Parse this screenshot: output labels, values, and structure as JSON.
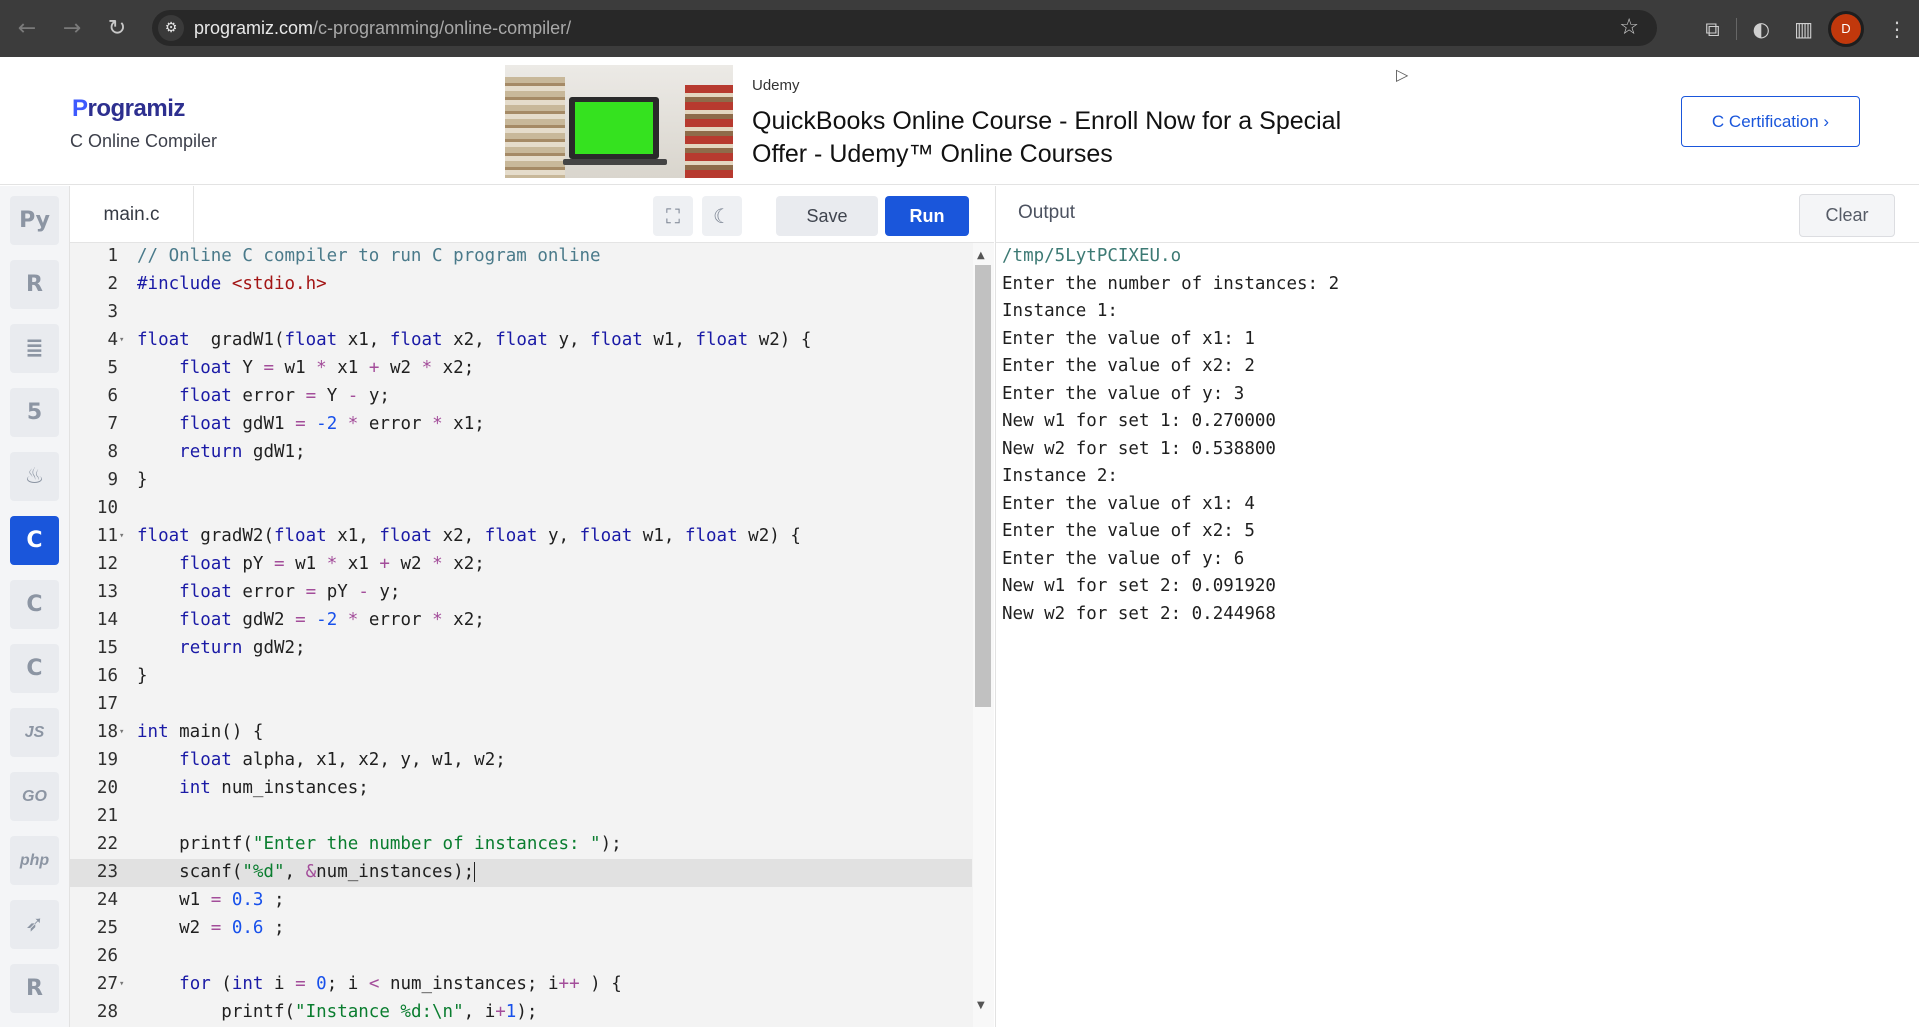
{
  "browser": {
    "url_host": "programiz.com",
    "url_path": "/c-programming/online-compiler/",
    "avatar_letter": "D"
  },
  "header": {
    "logo_text": "rogramiz",
    "logo_p": "P",
    "subtitle": "C Online Compiler",
    "ad_source": "Udemy",
    "ad_title": "QuickBooks Online Course - Enroll Now for a Special Offer - Udemy™ Online Courses",
    "cert_button": "C Certification ›"
  },
  "languages": [
    {
      "name": "python-icon",
      "glyph": "Py"
    },
    {
      "name": "r-icon",
      "glyph": "R"
    },
    {
      "name": "sql-icon",
      "glyph": "≣"
    },
    {
      "name": "html-icon",
      "glyph": "5"
    },
    {
      "name": "java-icon",
      "glyph": "♨"
    },
    {
      "name": "c-icon",
      "glyph": "C",
      "active": true
    },
    {
      "name": "cpp-icon",
      "glyph": "C"
    },
    {
      "name": "csharp-icon",
      "glyph": "C"
    },
    {
      "name": "javascript-icon",
      "glyph": "JS"
    },
    {
      "name": "go-icon",
      "glyph": "GO"
    },
    {
      "name": "php-icon",
      "glyph": "php"
    },
    {
      "name": "swift-icon",
      "glyph": "➶"
    },
    {
      "name": "rust-icon",
      "glyph": "R"
    }
  ],
  "editor": {
    "file_name": "main.c",
    "save_label": "Save",
    "run_label": "Run"
  },
  "code_lines": [
    [
      [
        "cm",
        "// Online C compiler to run C program online"
      ]
    ],
    [
      [
        "kw",
        "#include "
      ],
      [
        "inc",
        "<stdio.h>"
      ]
    ],
    [],
    [
      [
        "kw",
        "float"
      ],
      [
        "",
        "  gradW1("
      ],
      [
        "kw",
        "float"
      ],
      [
        "",
        " x1, "
      ],
      [
        "kw",
        "float"
      ],
      [
        "",
        " x2, "
      ],
      [
        "kw",
        "float"
      ],
      [
        "",
        " y, "
      ],
      [
        "kw",
        "float"
      ],
      [
        "",
        " w1, "
      ],
      [
        "kw",
        "float"
      ],
      [
        "",
        " w2) {"
      ]
    ],
    [
      [
        "",
        "    "
      ],
      [
        "kw",
        "float"
      ],
      [
        "",
        " Y "
      ],
      [
        "op",
        "="
      ],
      [
        "",
        " w1 "
      ],
      [
        "op",
        "*"
      ],
      [
        "",
        " x1 "
      ],
      [
        "op",
        "+"
      ],
      [
        "",
        " w2 "
      ],
      [
        "op",
        "*"
      ],
      [
        "",
        " x2;"
      ]
    ],
    [
      [
        "",
        "    "
      ],
      [
        "kw",
        "float"
      ],
      [
        "",
        " error "
      ],
      [
        "op",
        "="
      ],
      [
        "",
        " Y "
      ],
      [
        "op",
        "-"
      ],
      [
        "",
        " y;"
      ]
    ],
    [
      [
        "",
        "    "
      ],
      [
        "kw",
        "float"
      ],
      [
        "",
        " gdW1 "
      ],
      [
        "op",
        "="
      ],
      [
        " ",
        " "
      ],
      [
        "num",
        "-2"
      ],
      [
        "",
        " "
      ],
      [
        "op",
        "*"
      ],
      [
        "",
        " error "
      ],
      [
        "op",
        "*"
      ],
      [
        "",
        " x1;"
      ]
    ],
    [
      [
        "",
        "    "
      ],
      [
        "kw",
        "return"
      ],
      [
        "",
        " gdW1;"
      ]
    ],
    [
      [
        "",
        "}"
      ]
    ],
    [],
    [
      [
        "kw",
        "float"
      ],
      [
        "",
        " gradW2("
      ],
      [
        "kw",
        "float"
      ],
      [
        "",
        " x1, "
      ],
      [
        "kw",
        "float"
      ],
      [
        "",
        " x2, "
      ],
      [
        "kw",
        "float"
      ],
      [
        "",
        " y, "
      ],
      [
        "kw",
        "float"
      ],
      [
        "",
        " w1, "
      ],
      [
        "kw",
        "float"
      ],
      [
        "",
        " w2) {"
      ]
    ],
    [
      [
        "",
        "    "
      ],
      [
        "kw",
        "float"
      ],
      [
        "",
        " pY "
      ],
      [
        "op",
        "="
      ],
      [
        "",
        " w1 "
      ],
      [
        "op",
        "*"
      ],
      [
        "",
        " x1 "
      ],
      [
        "op",
        "+"
      ],
      [
        "",
        " w2 "
      ],
      [
        "op",
        "*"
      ],
      [
        "",
        " x2;"
      ]
    ],
    [
      [
        "",
        "    "
      ],
      [
        "kw",
        "float"
      ],
      [
        "",
        " error "
      ],
      [
        "op",
        "="
      ],
      [
        "",
        " pY "
      ],
      [
        "op",
        "-"
      ],
      [
        "",
        " y;"
      ]
    ],
    [
      [
        "",
        "    "
      ],
      [
        "kw",
        "float"
      ],
      [
        "",
        " gdW2 "
      ],
      [
        "op",
        "="
      ],
      [
        "",
        " "
      ],
      [
        "num",
        "-2"
      ],
      [
        "",
        " "
      ],
      [
        "op",
        "*"
      ],
      [
        "",
        " error "
      ],
      [
        "op",
        "*"
      ],
      [
        "",
        " x2;"
      ]
    ],
    [
      [
        "",
        "    "
      ],
      [
        "kw",
        "return"
      ],
      [
        "",
        " gdW2;"
      ]
    ],
    [
      [
        "",
        "}"
      ]
    ],
    [],
    [
      [
        "kw",
        "int"
      ],
      [
        "",
        " main() {"
      ]
    ],
    [
      [
        "",
        "    "
      ],
      [
        "kw",
        "float"
      ],
      [
        "",
        " alpha, x1, x2, y, w1, w2;"
      ]
    ],
    [
      [
        "",
        "    "
      ],
      [
        "kw",
        "int"
      ],
      [
        "",
        " num_instances;"
      ]
    ],
    [],
    [
      [
        "",
        "    printf("
      ],
      [
        "str",
        "\"Enter the number of instances: \""
      ],
      [
        "",
        ");"
      ]
    ],
    [
      [
        "",
        "    scanf("
      ],
      [
        "str",
        "\"%d\""
      ],
      [
        "",
        ", "
      ],
      [
        "op",
        "&"
      ],
      [
        "",
        "num_instances);"
      ]
    ],
    [
      [
        "",
        "    w1 "
      ],
      [
        "op",
        "="
      ],
      [
        "",
        " "
      ],
      [
        "num",
        "0.3"
      ],
      [
        "",
        " ;"
      ]
    ],
    [
      [
        "",
        "    w2 "
      ],
      [
        "op",
        "="
      ],
      [
        "",
        " "
      ],
      [
        "num",
        "0.6"
      ],
      [
        "",
        " ;"
      ]
    ],
    [],
    [
      [
        "",
        "    "
      ],
      [
        "kw",
        "for"
      ],
      [
        "",
        " ("
      ],
      [
        "kw",
        "int"
      ],
      [
        "",
        " i "
      ],
      [
        "op",
        "="
      ],
      [
        "",
        " "
      ],
      [
        "num",
        "0"
      ],
      [
        "",
        "; i "
      ],
      [
        "op",
        "<"
      ],
      [
        "",
        " num_instances; i"
      ],
      [
        "op",
        "++"
      ],
      [
        "",
        " ) {"
      ]
    ],
    [
      [
        "",
        "        printf("
      ],
      [
        "str",
        "\"Instance %d:\\n\""
      ],
      [
        "",
        ", i"
      ],
      [
        "op",
        "+"
      ],
      [
        "num",
        "1"
      ],
      [
        "",
        ");"
      ]
    ]
  ],
  "fold_lines": [
    4,
    11,
    18,
    27
  ],
  "highlight_line": 23,
  "output": {
    "title": "Output",
    "clear_label": "Clear",
    "lines": [
      "/tmp/5LytPCIXEU.o",
      "Enter the number of instances: 2",
      "Instance 1:",
      "Enter the value of x1: 1",
      "Enter the value of x2: 2",
      "Enter the value of y: 3",
      "New w1 for set 1: 0.270000",
      "New w2 for set 1: 0.538800",
      "Instance 2:",
      "Enter the value of x1: 4",
      "Enter the value of x2: 5",
      "Enter the value of y: 6",
      "New w1 for set 2: 0.091920",
      "New w2 for set 2: 0.244968"
    ]
  }
}
